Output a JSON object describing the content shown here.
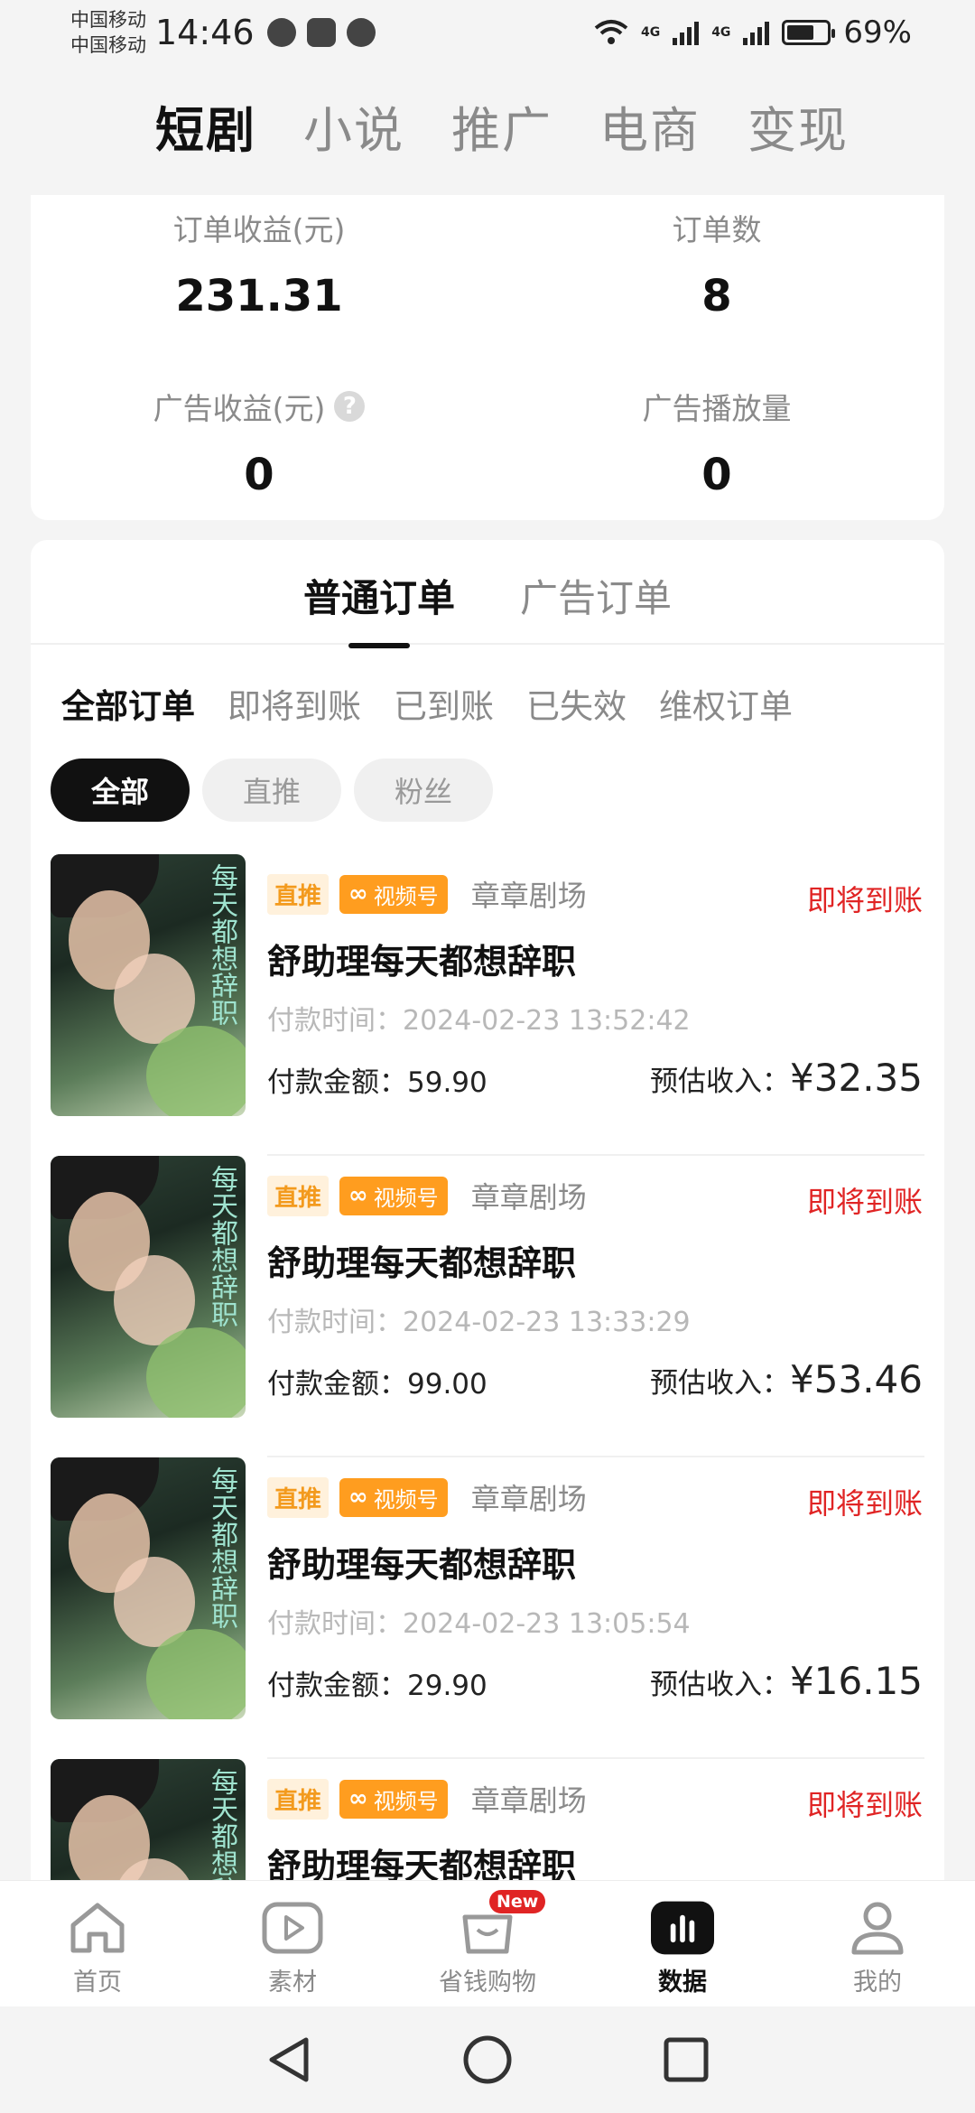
{
  "status_bar": {
    "carrier_1": "中国移动",
    "carrier_2": "中国移动",
    "time": "14:46",
    "network_1": "4G",
    "network_2": "4G",
    "battery_percent": "69%",
    "battery_level": 0.69
  },
  "top_tabs": [
    {
      "label": "短剧",
      "active": true
    },
    {
      "label": "小说",
      "active": false
    },
    {
      "label": "推广",
      "active": false
    },
    {
      "label": "电商",
      "active": false
    },
    {
      "label": "变现",
      "active": false
    }
  ],
  "stats": {
    "order_income_label": "订单收益(元)",
    "order_income_value": "231.31",
    "order_count_label": "订单数",
    "order_count_value": "8",
    "ad_income_label": "广告收益(元)",
    "ad_income_value": "0",
    "ad_plays_label": "广告播放量",
    "ad_plays_value": "0",
    "help_glyph": "?"
  },
  "order_tabs": {
    "normal": "普通订单",
    "ad": "广告订单"
  },
  "filters": [
    "全部订单",
    "即将到账",
    "已到账",
    "已失效",
    "维权订单"
  ],
  "chips": [
    "全部",
    "直推",
    "粉丝"
  ],
  "orders": [
    {
      "tag_direct": "直推",
      "tag_video": "视频号",
      "studio": "章章剧场",
      "status": "即将到账",
      "title": "舒助理每天都想辞职",
      "pay_time": "付款时间：2024-02-23 13:52:42",
      "pay_amount": "付款金额：59.90",
      "income_label": "预估收入：",
      "income_value": "¥32.35"
    },
    {
      "tag_direct": "直推",
      "tag_video": "视频号",
      "studio": "章章剧场",
      "status": "即将到账",
      "title": "舒助理每天都想辞职",
      "pay_time": "付款时间：2024-02-23 13:33:29",
      "pay_amount": "付款金额：99.00",
      "income_label": "预估收入：",
      "income_value": "¥53.46"
    },
    {
      "tag_direct": "直推",
      "tag_video": "视频号",
      "studio": "章章剧场",
      "status": "即将到账",
      "title": "舒助理每天都想辞职",
      "pay_time": "付款时间：2024-02-23 13:05:54",
      "pay_amount": "付款金额：29.90",
      "income_label": "预估收入：",
      "income_value": "¥16.15"
    },
    {
      "tag_direct": "直推",
      "tag_video": "视频号",
      "studio": "章章剧场",
      "status": "即将到账",
      "title": "舒助理每天都想辞职"
    }
  ],
  "bottom_nav": {
    "home": "首页",
    "material": "素材",
    "shopping": "省钱购物",
    "shopping_badge": "New",
    "data": "数据",
    "mine": "我的"
  },
  "colors": {
    "accent_red": "#e02424",
    "tag_orange": "#ff9d1f",
    "active_black": "#111111"
  }
}
